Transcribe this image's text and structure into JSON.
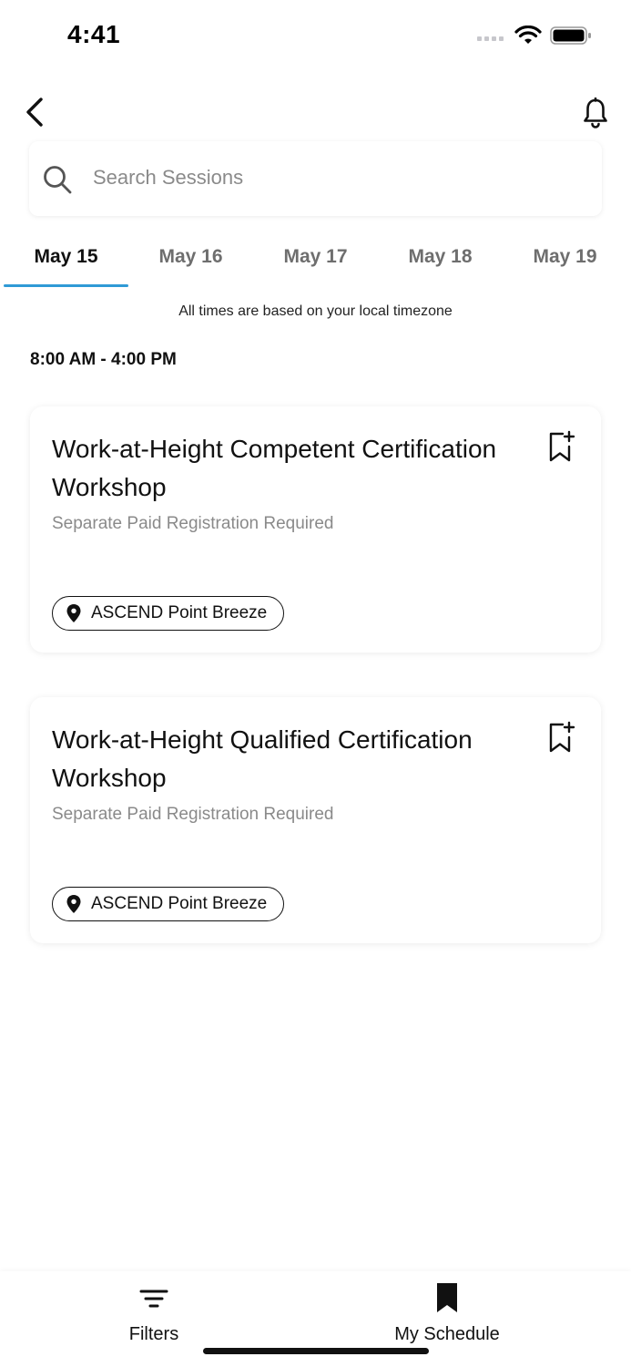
{
  "status_bar": {
    "time": "4:41"
  },
  "nav": {
    "back_icon": "chevron-left-icon",
    "notifications_icon": "bell-icon"
  },
  "search": {
    "placeholder": "Search Sessions",
    "value": "",
    "icon": "search-icon"
  },
  "tabs": [
    {
      "label": "May 15",
      "active": true
    },
    {
      "label": "May 16",
      "active": false
    },
    {
      "label": "May 17",
      "active": false
    },
    {
      "label": "May 18",
      "active": false
    },
    {
      "label": "May 19",
      "active": false
    }
  ],
  "accent_color": "#2f9ad6",
  "timezone_note": "All times are based on your local timezone",
  "time_block": "8:00 AM - 4:00 PM",
  "sessions": [
    {
      "title": "Work-at-Height Competent Certification Workshop",
      "subtitle": "Separate Paid Registration Required",
      "location": "ASCEND Point Breeze",
      "bookmark_icon": "bookmark-add-icon",
      "location_icon": "map-pin-icon"
    },
    {
      "title": "Work-at-Height Qualified Certification Workshop",
      "subtitle": "Separate Paid Registration Required",
      "location": "ASCEND Point Breeze",
      "bookmark_icon": "bookmark-add-icon",
      "location_icon": "map-pin-icon"
    }
  ],
  "bottom_nav": {
    "filters_label": "Filters",
    "filters_icon": "filter-icon",
    "schedule_label": "My Schedule",
    "schedule_icon": "bookmark-icon"
  }
}
